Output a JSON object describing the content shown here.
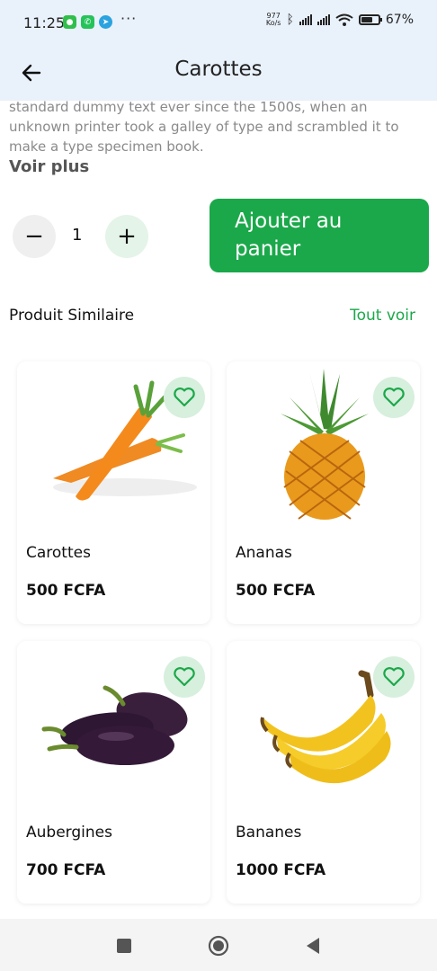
{
  "status_bar": {
    "time": "11:25",
    "more": "···",
    "speed_value": "977",
    "speed_unit": "Ko/s",
    "battery": "67%",
    "battery_level": 0.67
  },
  "header": {
    "title": "Carottes",
    "back_icon": "arrow-left-icon"
  },
  "product": {
    "description": "standard dummy text ever since the 1500s, when an unknown printer took a galley of type and scrambled it to make a type specimen book.",
    "see_more": "Voir plus",
    "quantity": "1",
    "minus_label": "−",
    "plus_label": "+",
    "add_to_cart": "Ajouter au panier"
  },
  "similar": {
    "title": "Produit Similaire",
    "see_all": "Tout voir",
    "items": [
      {
        "name": "Carottes",
        "price": "500 FCFA",
        "image": "carrot"
      },
      {
        "name": "Ananas",
        "price": "500 FCFA",
        "image": "pineapple"
      },
      {
        "name": "Aubergines",
        "price": "700 FCFA",
        "image": "eggplant"
      },
      {
        "name": "Bananes",
        "price": "1000 FCFA",
        "image": "banana"
      }
    ]
  },
  "colors": {
    "accent": "#1ba84a",
    "header_bg": "#e9f1fb",
    "fav_bg": "#d7efdd"
  },
  "nav": {
    "icons": [
      "square-icon",
      "home-circle-icon",
      "back-triangle-icon"
    ]
  }
}
